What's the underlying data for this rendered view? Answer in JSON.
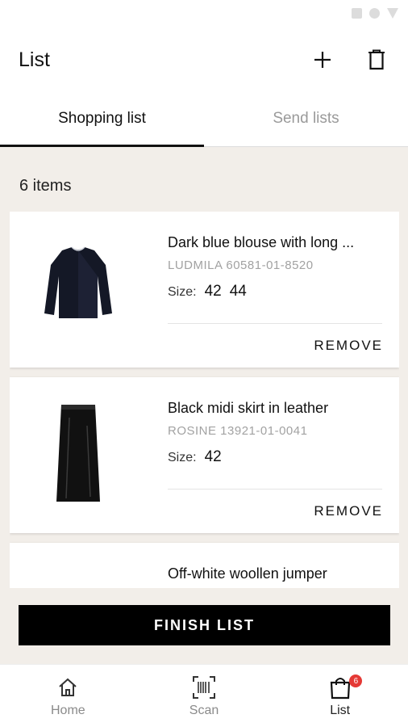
{
  "app_bar": {
    "title": "List",
    "add_icon": "plus-icon",
    "delete_icon": "trash-icon"
  },
  "tabs": [
    {
      "label": "Shopping list",
      "active": true
    },
    {
      "label": "Send lists",
      "active": false
    }
  ],
  "summary": {
    "count_text": "6 items"
  },
  "items": [
    {
      "name": "Dark blue blouse with long ...",
      "code": "LUDMILA 60581-01-8520",
      "size_label": "Size:",
      "sizes": [
        "42",
        "44"
      ],
      "remove_label": "REMOVE",
      "image_icon": "blouse-image"
    },
    {
      "name": "Black midi skirt in leather",
      "code": "ROSINE 13921-01-0041",
      "size_label": "Size:",
      "sizes": [
        "42"
      ],
      "remove_label": "REMOVE",
      "image_icon": "skirt-image"
    },
    {
      "name": "Off-white woollen jumper",
      "image_icon": "jumper-image"
    }
  ],
  "finish_button": {
    "label": "FINISH LIST"
  },
  "bottom_nav": [
    {
      "label": "Home",
      "icon": "home-icon",
      "active": false
    },
    {
      "label": "Scan",
      "icon": "barcode-icon",
      "active": false
    },
    {
      "label": "List",
      "icon": "shopping-bag-icon",
      "active": true,
      "badge": "6"
    }
  ],
  "colors": {
    "background": "#f2eee9",
    "primary": "#000000",
    "badge": "#e53935",
    "muted_text": "#a2a2a2"
  }
}
